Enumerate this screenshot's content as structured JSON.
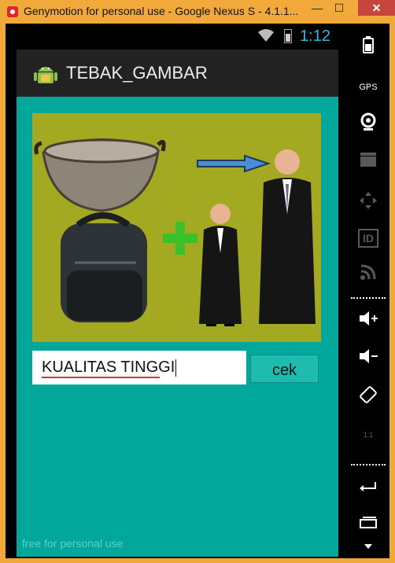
{
  "window": {
    "title": "Genymotion for personal use - Google Nexus S - 4.1.1...",
    "minimize": "—",
    "maximize": "☐",
    "close": "✕"
  },
  "statusbar": {
    "time": "1:12"
  },
  "actionbar": {
    "title": "TEBAK_GAMBAR"
  },
  "main": {
    "answer_value": "KUALITAS TINGGI",
    "check_label": "cek"
  },
  "watermark": "free for personal use",
  "sidebar": {
    "gps_label": "GPS",
    "id_label": "ID",
    "scale_label": "1:1"
  },
  "colors": {
    "content_bg": "#00a79a",
    "puzzle_bg": "#a3a920",
    "accent_time": "#33b5e5"
  }
}
